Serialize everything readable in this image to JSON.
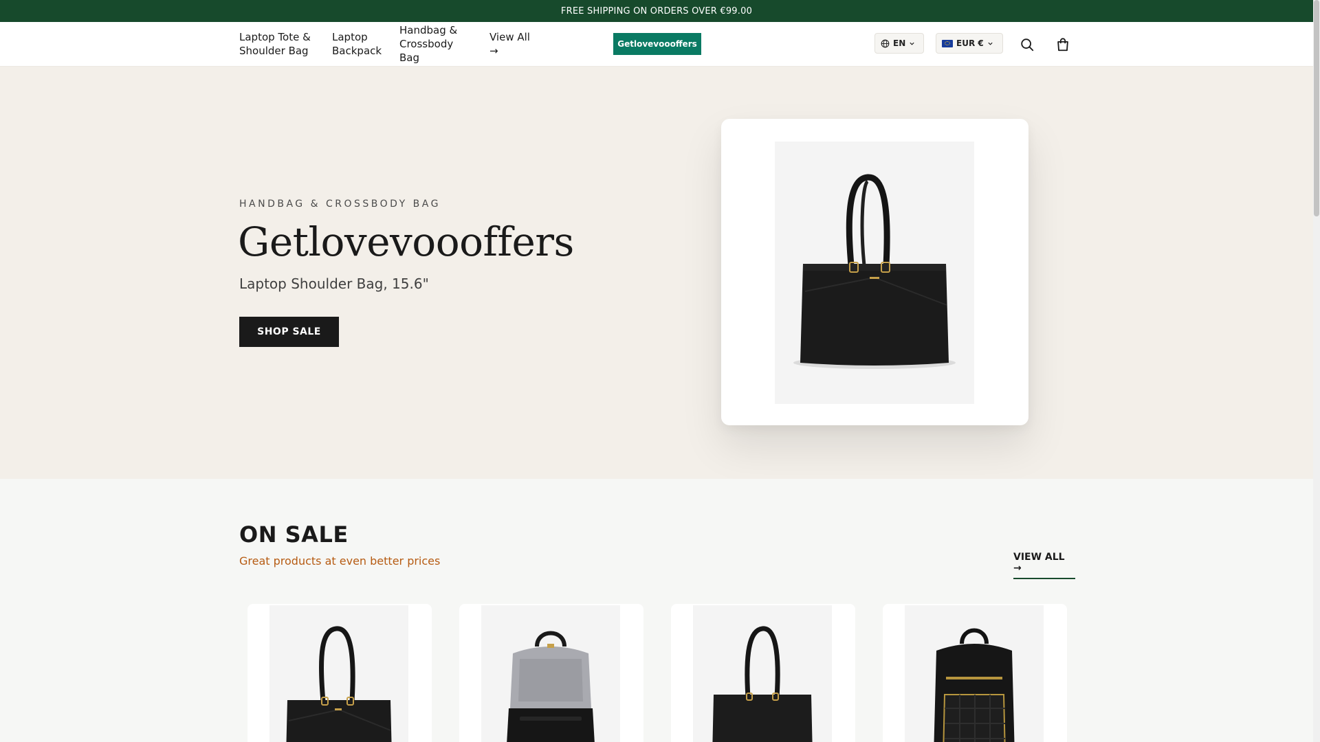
{
  "announcement": {
    "text": "FREE SHIPPING ON ORDERS OVER €99.00"
  },
  "nav": {
    "items": [
      {
        "label": "Laptop Tote & Shoulder Bag"
      },
      {
        "label": "Laptop Backpack"
      },
      {
        "label": "Handbag & Crossbody Bag"
      },
      {
        "label": "View All →"
      }
    ]
  },
  "header": {
    "promo_button": "Getlovevoooffers",
    "language": "EN",
    "currency": "EUR €",
    "icons": [
      "globe-icon",
      "chevron-down-icon",
      "eu-flag-icon",
      "search-icon",
      "cart-icon"
    ]
  },
  "hero": {
    "eyebrow": "HANDBAG & CROSSBODY BAG",
    "title": "Getlovevoooffers",
    "subtitle": "Laptop Shoulder Bag, 15.6\"",
    "cta": "SHOP SALE"
  },
  "on_sale": {
    "title": "ON SALE",
    "subtitle": "Great products at even better prices",
    "view_all": "VIEW ALL →",
    "products": [
      {
        "image": "black-tote-bag"
      },
      {
        "image": "grey-laptop-backpack"
      },
      {
        "image": "black-shoulder-bag"
      },
      {
        "image": "black-quilted-backpack"
      }
    ]
  },
  "colors": {
    "announcement_bg": "#174a2c",
    "promo_button_bg": "#0a7a63",
    "hero_bg": "#f3efe9",
    "sale_subtitle": "#b65b12",
    "cta_bg": "#1a1a1a"
  }
}
